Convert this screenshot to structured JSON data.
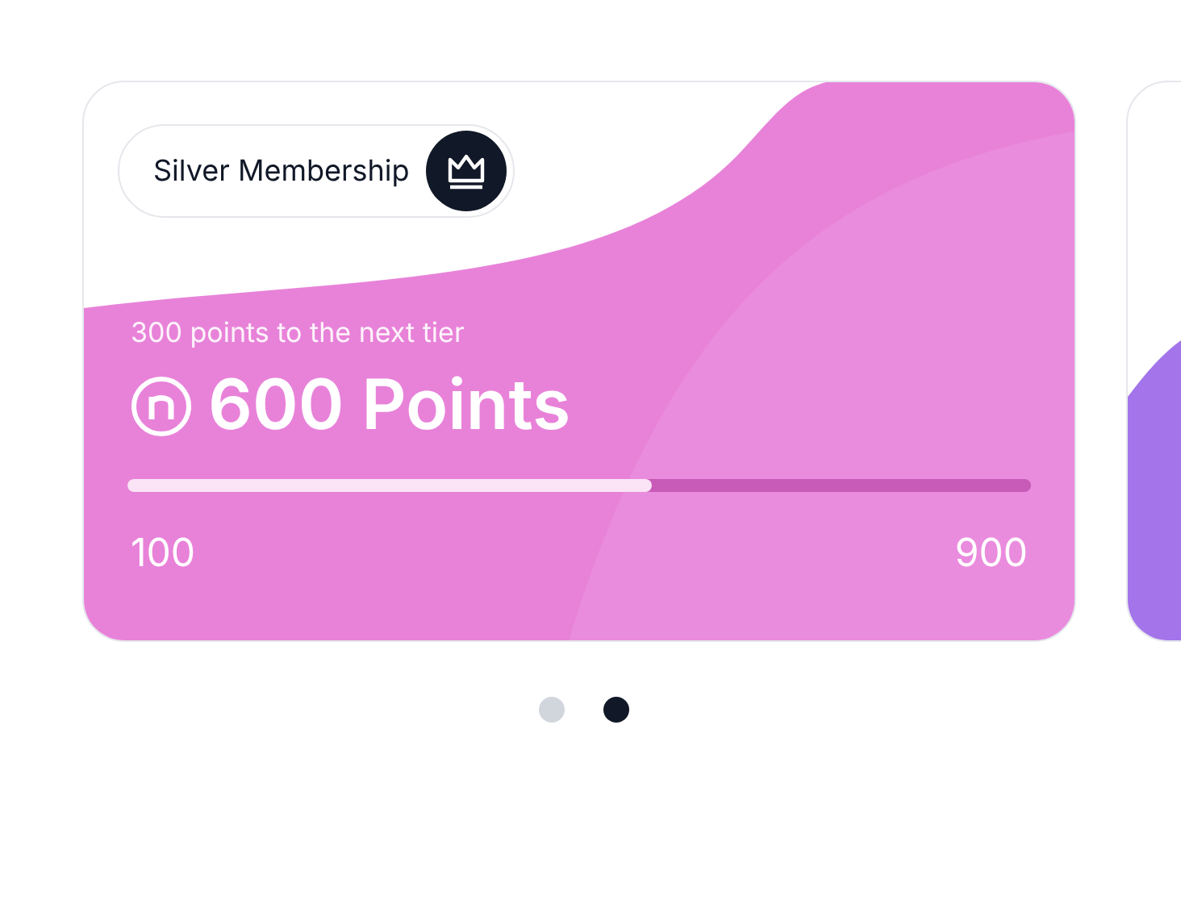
{
  "cards": [
    {
      "kind": "membership",
      "tier": "Silver Membership",
      "hint": "300 points to the next tier",
      "points": "600 Points",
      "progress": {
        "level": 0.58,
        "min": "100",
        "max": "900"
      }
    },
    {
      "kind": "peek"
    }
  ],
  "pagination": [
    {
      "selected": false
    },
    {
      "selected": true
    }
  ]
}
